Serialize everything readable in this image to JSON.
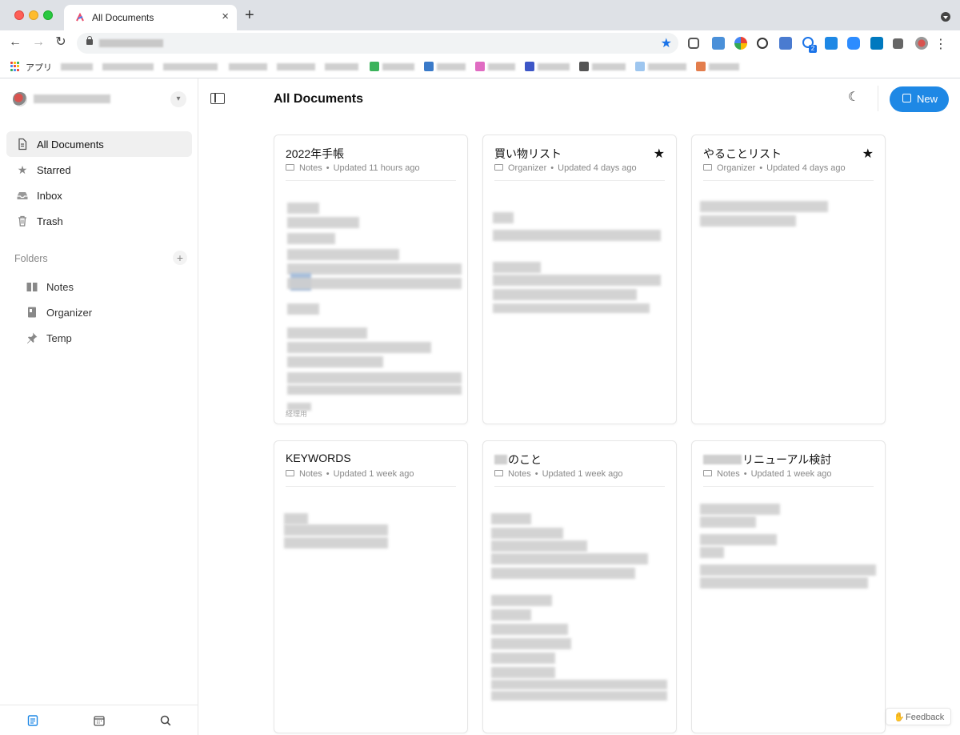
{
  "browser": {
    "tab_title": "All Documents",
    "tab_close": "×",
    "new_tab": "+",
    "back": "←",
    "forward": "→",
    "reload": "↻",
    "bookmark_star": "★",
    "menu": "⋮",
    "bookmarks_apps_label": "アプリ"
  },
  "sidebar": {
    "nav": [
      {
        "label": "All Documents",
        "icon": "document-icon",
        "active": true
      },
      {
        "label": "Starred",
        "icon": "star-icon",
        "active": false
      },
      {
        "label": "Inbox",
        "icon": "inbox-icon",
        "active": false
      },
      {
        "label": "Trash",
        "icon": "trash-icon",
        "active": false
      }
    ],
    "folders_heading": "Folders",
    "folders_add": "+",
    "folders": [
      {
        "label": "Notes",
        "icon": "book-icon"
      },
      {
        "label": "Organizer",
        "icon": "notebook-icon"
      },
      {
        "label": "Temp",
        "icon": "pin-icon"
      }
    ]
  },
  "header": {
    "title": "All Documents",
    "new_button": "New"
  },
  "cards": [
    {
      "title": "2022年手帳",
      "folder": "Notes",
      "updated": "Updated 11 hours ago",
      "starred": false,
      "footer": "経理用"
    },
    {
      "title": "買い物リスト",
      "folder": "Organizer",
      "updated": "Updated 4 days ago",
      "starred": true,
      "footer": ""
    },
    {
      "title": "やることリスト",
      "folder": "Organizer",
      "updated": "Updated 4 days ago",
      "starred": true,
      "footer": ""
    },
    {
      "title": "KEYWORDS",
      "folder": "Notes",
      "updated": "Updated 1 week ago",
      "starred": false,
      "footer": ""
    },
    {
      "title": "のこと",
      "folder": "Notes",
      "updated": "Updated 1 week ago",
      "starred": false,
      "footer": ""
    },
    {
      "title": "リニューアル検討",
      "folder": "Notes",
      "updated": "Updated 1 week ago",
      "starred": false,
      "footer": ""
    }
  ],
  "feedback_label": "Feedback",
  "colors": {
    "accent": "#1e88e5",
    "active_nav_bg": "#f0f0f0"
  }
}
